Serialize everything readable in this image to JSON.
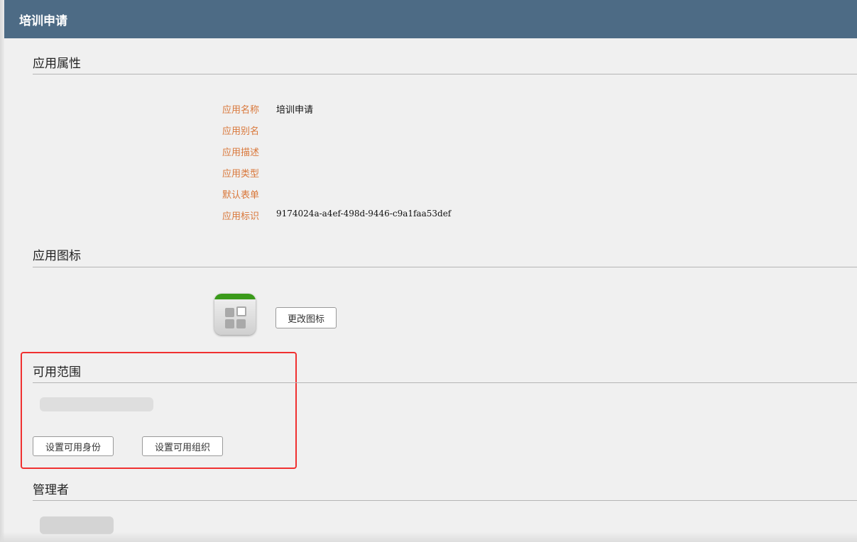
{
  "header": {
    "title": "培训申请"
  },
  "properties": {
    "title": "应用属性",
    "fields": [
      {
        "label": "应用名称",
        "value": "培训申请"
      },
      {
        "label": "应用别名",
        "value": ""
      },
      {
        "label": "应用描述",
        "value": ""
      },
      {
        "label": "应用类型",
        "value": ""
      },
      {
        "label": "默认表单",
        "value": ""
      },
      {
        "label": "应用标识",
        "value": "9174024a-a4ef-498d-9446-c9a1faa53def"
      }
    ]
  },
  "icon_section": {
    "title": "应用图标",
    "change_button": "更改图标"
  },
  "scope": {
    "title": "可用范围",
    "set_identity_button": "设置可用身份",
    "set_org_button": "设置可用组织"
  },
  "admins": {
    "title": "管理者"
  }
}
